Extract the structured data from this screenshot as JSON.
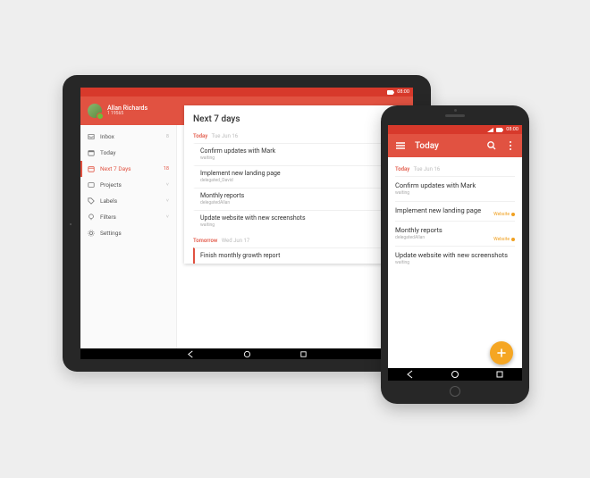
{
  "status": {
    "time": "08:00"
  },
  "tablet": {
    "user_name": "Allan Richards",
    "user_sub": "1 19565",
    "sidebar": [
      {
        "icon": "inbox-icon",
        "label": "Inbox",
        "tail": "8",
        "active": false
      },
      {
        "icon": "today-icon",
        "label": "Today",
        "tail": "",
        "active": false
      },
      {
        "icon": "calendar-icon",
        "label": "Next 7 Days",
        "tail": "18",
        "active": true
      },
      {
        "icon": "projects-icon",
        "label": "Projects",
        "tail": "˅",
        "active": false
      },
      {
        "icon": "labels-icon",
        "label": "Labels",
        "tail": "˅",
        "active": false
      },
      {
        "icon": "filters-icon",
        "label": "Filters",
        "tail": "˅",
        "active": false
      },
      {
        "icon": "settings-icon",
        "label": "Settings",
        "tail": "",
        "active": false
      }
    ],
    "main_title": "Next 7 days",
    "today_label": "Today",
    "today_date": "Tue Jun 16",
    "tasks_today": [
      {
        "title": "Confirm updates with Mark",
        "sub": "waiting"
      },
      {
        "title": "Implement new landing page",
        "sub": "delegated_David"
      },
      {
        "title": "Monthly reports",
        "sub": "delegatedAllan"
      },
      {
        "title": "Update website with new screenshots",
        "sub": "waiting"
      }
    ],
    "tomorrow_label": "Tomorrow",
    "tomorrow_date": "Wed Jun 17",
    "tasks_tomorrow": [
      {
        "title": "Finish monthly growth report",
        "sub": ""
      }
    ]
  },
  "phone": {
    "title": "Today",
    "today_label": "Today",
    "today_date": "Tue Jun 16",
    "tasks": [
      {
        "title": "Confirm updates with Mark",
        "sub": "waiting",
        "tag": ""
      },
      {
        "title": "Implement new landing page",
        "sub": "",
        "tag": "Website"
      },
      {
        "title": "Monthly reports",
        "sub": "delegatedAllan",
        "tag": "Website"
      },
      {
        "title": "Update website with new screenshots",
        "sub": "waiting",
        "tag": ""
      }
    ]
  }
}
